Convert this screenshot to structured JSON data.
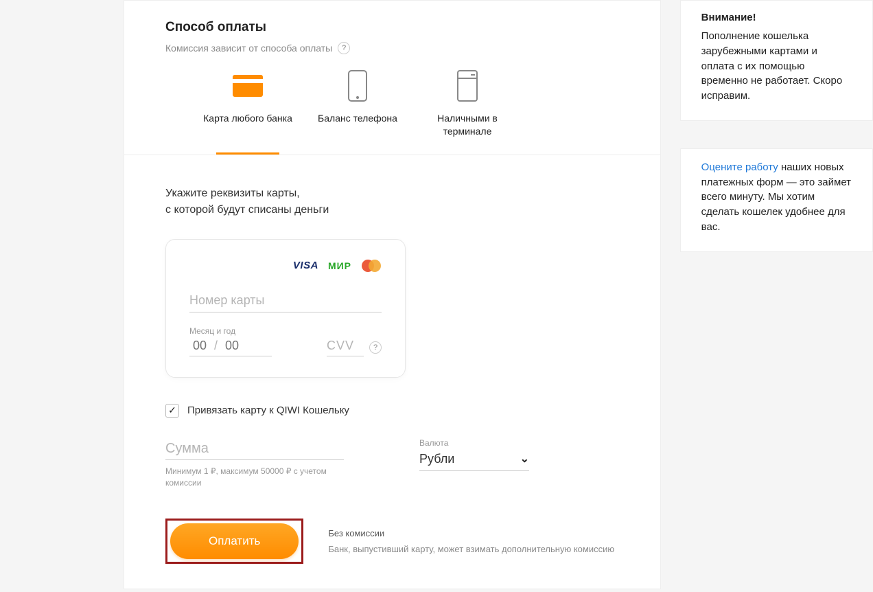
{
  "section": {
    "title": "Способ оплаты",
    "subtitle": "Комиссия зависит от способа оплаты",
    "help": "?"
  },
  "methods": {
    "card": "Карта любого банка",
    "phone": "Баланс телефона",
    "cash": "Наличными в терминале"
  },
  "instruction": {
    "line1": "Укажите реквизиты карты,",
    "line2": "с которой будут списаны деньги"
  },
  "card": {
    "brands": {
      "visa": "VISA",
      "mir": "МИР"
    },
    "number_placeholder": "Номер карты",
    "exp_label": "Месяц и год",
    "month_placeholder": "00",
    "year_placeholder": "00",
    "sep": "/",
    "cvv_placeholder": "CVV",
    "cvv_help": "?"
  },
  "bind": {
    "label": "Привязать карту к QIWI Кошельку"
  },
  "amount": {
    "placeholder": "Сумма",
    "hint": "Минимум 1 ₽, максимум 50000 ₽ с учетом комиссии"
  },
  "currency": {
    "label": "Валюта",
    "value": "Рубли"
  },
  "pay": {
    "button": "Оплатить",
    "info_title": "Без комиссии",
    "info_text": "Банк, выпустивший карту, может взимать дополнительную комиссию"
  },
  "sidebar": {
    "warn_title": "Внимание!",
    "warn_text": "Пополнение кошелька зарубежными картами и оплата с их помощью временно не работает. Скоро исправим.",
    "rate_link": "Оцените работу",
    "rate_text": " наших новых платежных форм — это займет всего минуту. Мы хотим сделать кошелек удобнее для вас."
  }
}
